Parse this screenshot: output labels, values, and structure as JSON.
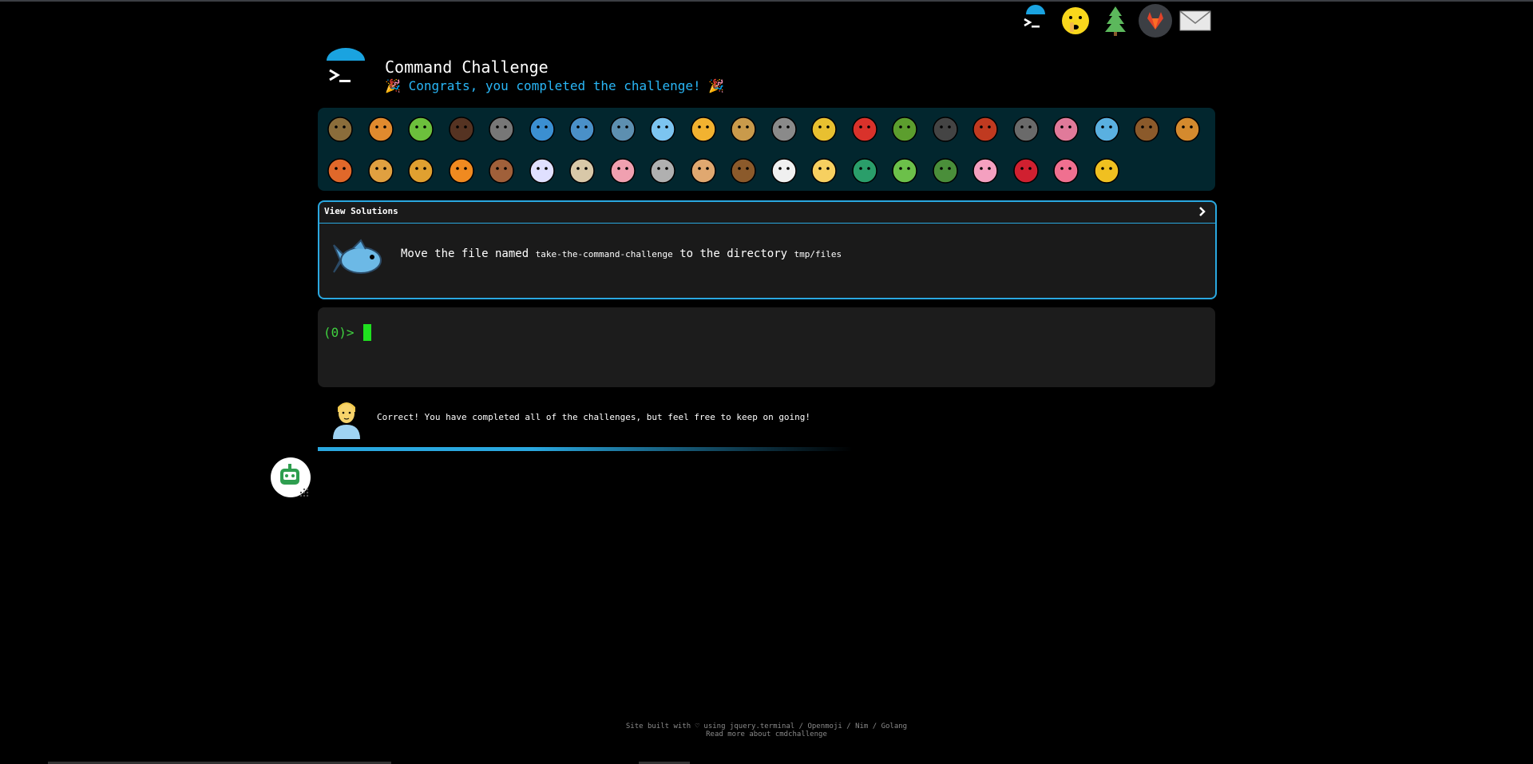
{
  "header": {
    "title": "Command Challenge",
    "subtitle": "Congrats, you completed the challenge!",
    "party_left": "🎉",
    "party_right": "🎉"
  },
  "top_icons": [
    "terminal-icon",
    "shushing-face-icon",
    "tree-icon",
    "gitlab-icon",
    "mail-icon"
  ],
  "animals": {
    "row1": [
      "snail",
      "butterfly",
      "caterpillar",
      "ant",
      "spider-web",
      "whale",
      "shark",
      "dolphin",
      "fish",
      "tropical-fish",
      "blowfish",
      "wolf",
      "bee",
      "ladybug",
      "grasshopper",
      "spider",
      "scorpion",
      "fly",
      "worm",
      "microbe",
      "monkey",
      "dog"
    ],
    "row2": [
      "fox",
      "cat",
      "lion",
      "tiger",
      "horse",
      "unicorn",
      "cow",
      "pig",
      "mouse",
      "hamster",
      "bear",
      "panda",
      "chick",
      "peacock",
      "frog",
      "dragon",
      "cherry-blossom",
      "rose",
      "hibiscus",
      "sunflower"
    ]
  },
  "challenge": {
    "view_solutions": "View Solutions",
    "text_before": "Move the file named ",
    "filename": "take-the-command-challenge",
    "text_middle": " to the directory ",
    "directory": "tmp/files"
  },
  "terminal": {
    "prompt": "(0)>"
  },
  "result": {
    "message": "Correct! You have completed all of the challenges, but feel free to keep on going!"
  },
  "footer": {
    "line1": "Site built with ♡ using jquery.terminal / Openmoji / Nim / Golang",
    "line2": "Read more about cmdchallenge"
  },
  "colors": {
    "accent": "#2aa8e0",
    "prompt": "#3fd13f",
    "panel": "#02262e"
  }
}
